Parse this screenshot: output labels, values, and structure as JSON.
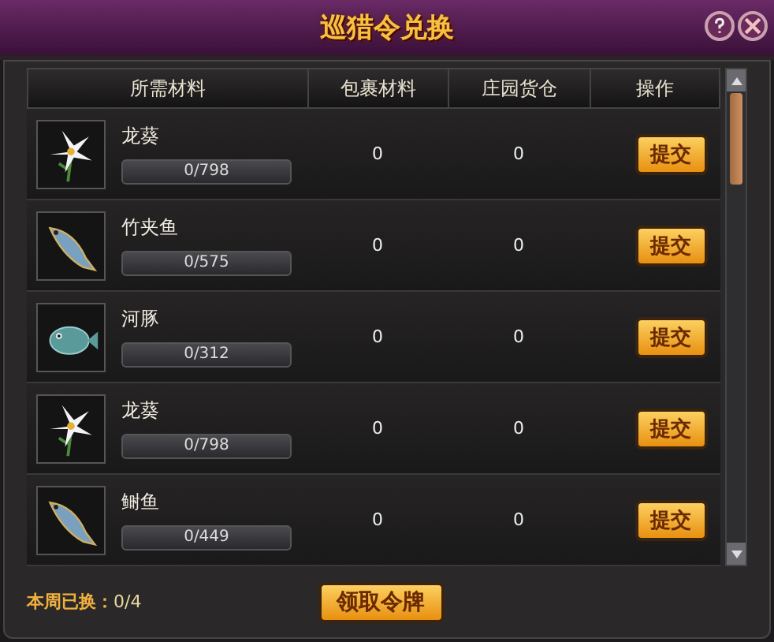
{
  "window": {
    "title": "巡猎令兑换"
  },
  "table": {
    "columns": [
      "所需材料",
      "包裹材料",
      "庄园货仓",
      "操作"
    ],
    "rows": [
      {
        "kind": "flower",
        "name": "龙葵",
        "progress": "0/798",
        "level": 0,
        "bag": "0",
        "warehouse": "0",
        "action": "提交"
      },
      {
        "kind": "fish",
        "name": "竹夹鱼",
        "progress": "0/575",
        "level": 0,
        "bag": "0",
        "warehouse": "0",
        "action": "提交"
      },
      {
        "kind": "puffer",
        "name": "河豚",
        "progress": "0/312",
        "level": 0,
        "bag": "0",
        "warehouse": "0",
        "action": "提交"
      },
      {
        "kind": "flower",
        "name": "龙葵",
        "progress": "0/798",
        "level": 0,
        "bag": "0",
        "warehouse": "0",
        "action": "提交"
      },
      {
        "kind": "fish",
        "name": "鲥鱼",
        "progress": "0/449",
        "level": 0,
        "bag": "0",
        "warehouse": "0",
        "action": "提交"
      }
    ]
  },
  "footer": {
    "label": "本周已换：",
    "count": "0/4",
    "button": "领取令牌"
  }
}
